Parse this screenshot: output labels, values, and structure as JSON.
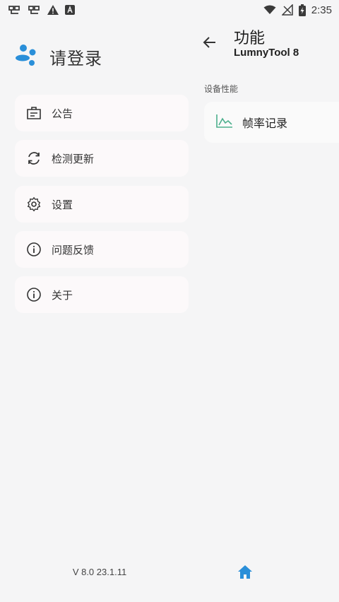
{
  "status_bar": {
    "time": "2:35",
    "left_icons": [
      "bug-icon",
      "bug-icon",
      "warning-icon",
      "a-badge-icon"
    ],
    "right_icons": [
      "wifi-icon",
      "no-signal-icon",
      "battery-charging-icon"
    ]
  },
  "drawer": {
    "profile_name": "请登录",
    "menu": [
      {
        "label": "公告",
        "icon": "announcement-icon"
      },
      {
        "label": "检测更新",
        "icon": "refresh-icon"
      },
      {
        "label": "设置",
        "icon": "gear-icon"
      },
      {
        "label": "问题反馈",
        "icon": "info-icon"
      },
      {
        "label": "关于",
        "icon": "info-icon"
      }
    ],
    "version": "V 8.0 23.1.11"
  },
  "content": {
    "title": "功能",
    "subtitle": "LumnyTool 8",
    "section": "设备性能",
    "items": [
      {
        "label": "帧率记录",
        "icon": "chart-line-icon"
      }
    ]
  },
  "colors": {
    "background": "#f5f5f6",
    "card": "#fcf9fa",
    "accent_blue": "#2a8fd9",
    "chart_green": "#4caf8d"
  }
}
